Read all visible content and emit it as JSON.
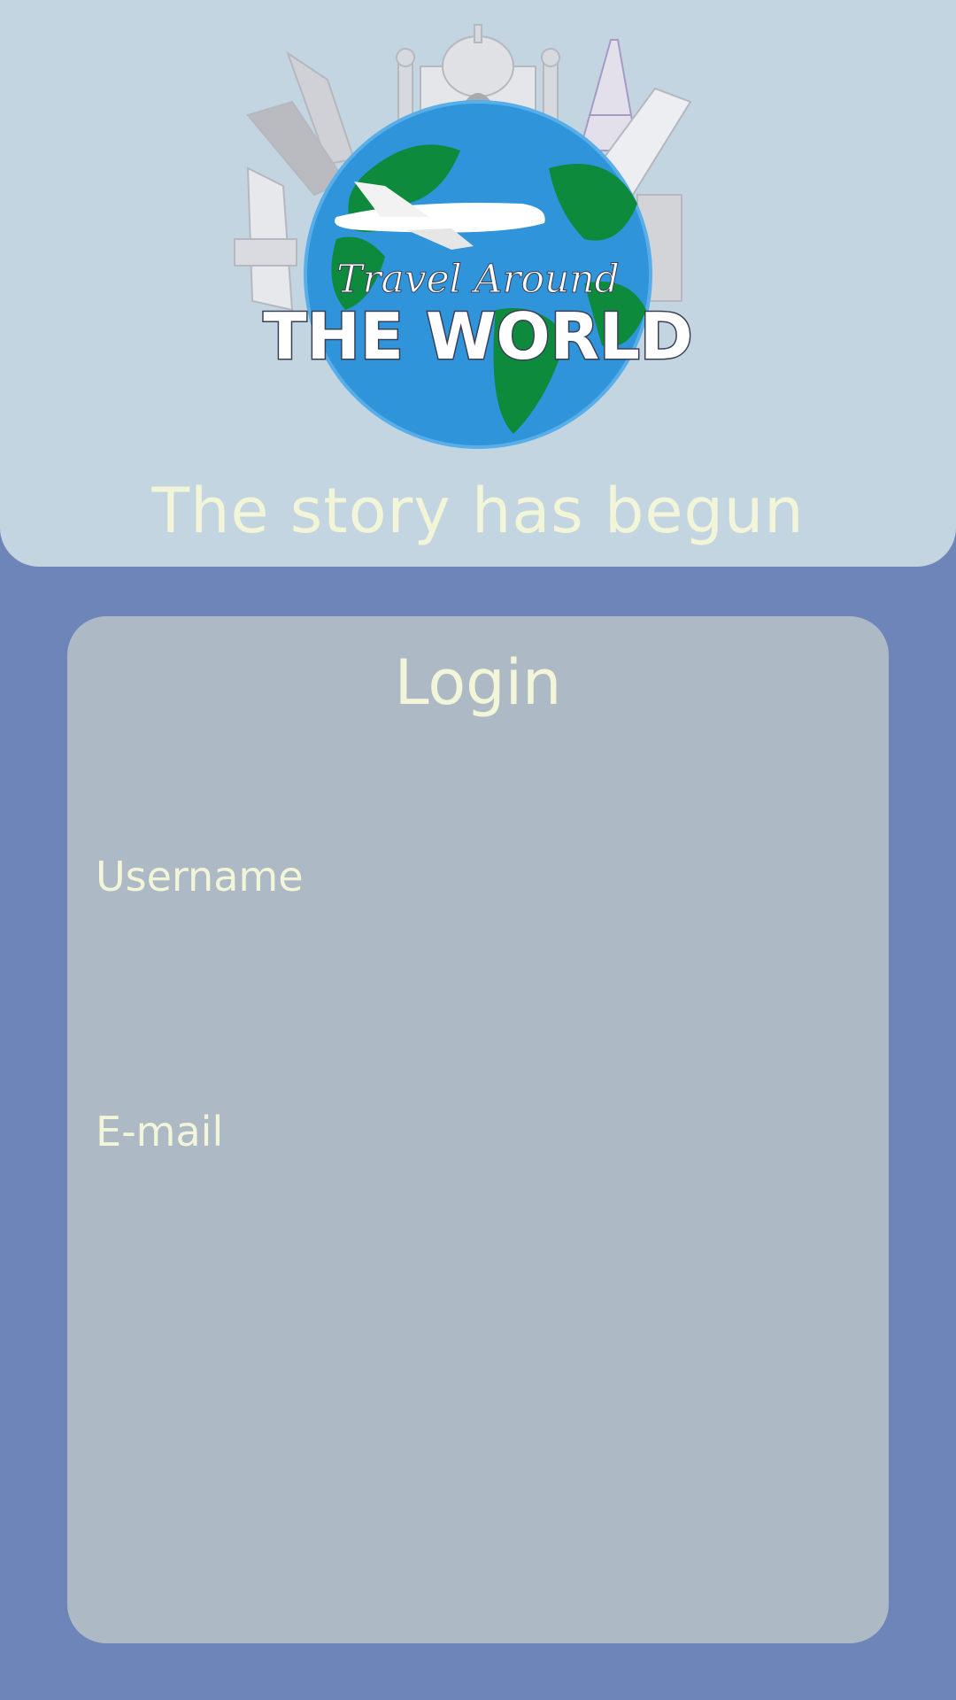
{
  "header": {
    "logo": {
      "script_line": "Travel Around",
      "title_line": "THE WORLD"
    },
    "tagline": "The story has begun"
  },
  "login": {
    "title": "Login",
    "username_label": "Username",
    "username_value": "",
    "email_label": "E-mail",
    "email_value": ""
  },
  "colors": {
    "page_background": "#6d85b8",
    "header_background": "#c3d5e0",
    "card_background": "#aeb9c6",
    "text": "#f3f5d8"
  }
}
